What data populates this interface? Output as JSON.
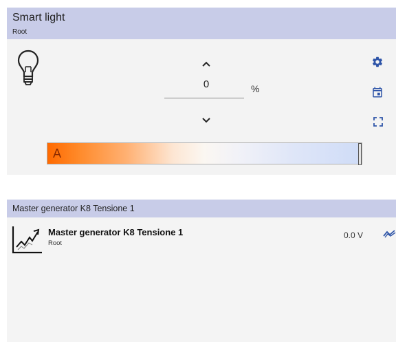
{
  "smart_light": {
    "title": "Smart light",
    "subtitle": "Root",
    "value": "0",
    "unit": "%",
    "bar_label": "A",
    "level_fraction": 1.0,
    "icons": [
      "lightbulb-icon",
      "chevron-up-icon",
      "chevron-down-icon",
      "gear-icon",
      "calendar-icon",
      "fullscreen-icon"
    ],
    "colors": {
      "header": "#c8cce8",
      "accent_blue": "#2f55a8",
      "gradient_warm": "#ff6a00",
      "gradient_cool": "#cfdcf7"
    }
  },
  "generator": {
    "header_title": "Master generator K8 Tensione 1",
    "title": "Master generator K8 Tensione 1",
    "subtitle": "Root",
    "value": "0.0 V",
    "icons": [
      "line-chart-icon",
      "trend-icon"
    ]
  }
}
